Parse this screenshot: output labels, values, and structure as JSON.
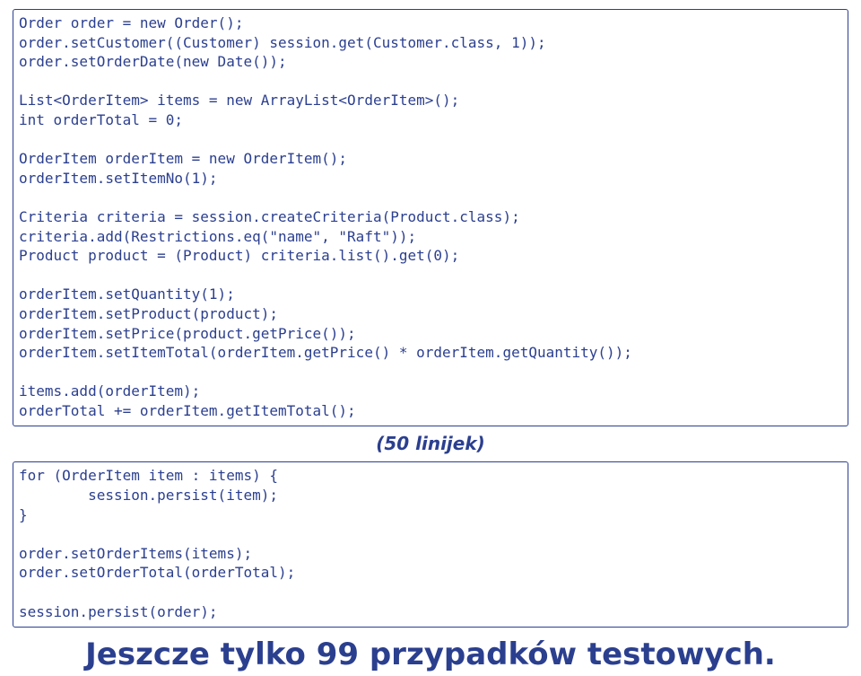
{
  "code1": {
    "lines": [
      "Order order = new Order();",
      "order.setCustomer((Customer) session.get(Customer.class, 1));",
      "order.setOrderDate(new Date());",
      "",
      "List<OrderItem> items = new ArrayList<OrderItem>();",
      "int orderTotal = 0;",
      "",
      "OrderItem orderItem = new OrderItem();",
      "orderItem.setItemNo(1);",
      "",
      "Criteria criteria = session.createCriteria(Product.class);",
      "criteria.add(Restrictions.eq(\"name\", \"Raft\"));",
      "Product product = (Product) criteria.list().get(0);",
      "",
      "orderItem.setQuantity(1);",
      "orderItem.setProduct(product);",
      "orderItem.setPrice(product.getPrice());",
      "orderItem.setItemTotal(orderItem.getPrice() * orderItem.getQuantity());",
      "",
      "items.add(orderItem);",
      "orderTotal += orderItem.getItemTotal();"
    ]
  },
  "caption": "(50 linijek)",
  "code2": {
    "lines": [
      "for (OrderItem item : items) {",
      "        session.persist(item);",
      "}",
      "",
      "order.setOrderItems(items);",
      "order.setOrderTotal(orderTotal);",
      "",
      "session.persist(order);"
    ]
  },
  "headline": "Jeszcze tylko 99 przypadków testowych."
}
